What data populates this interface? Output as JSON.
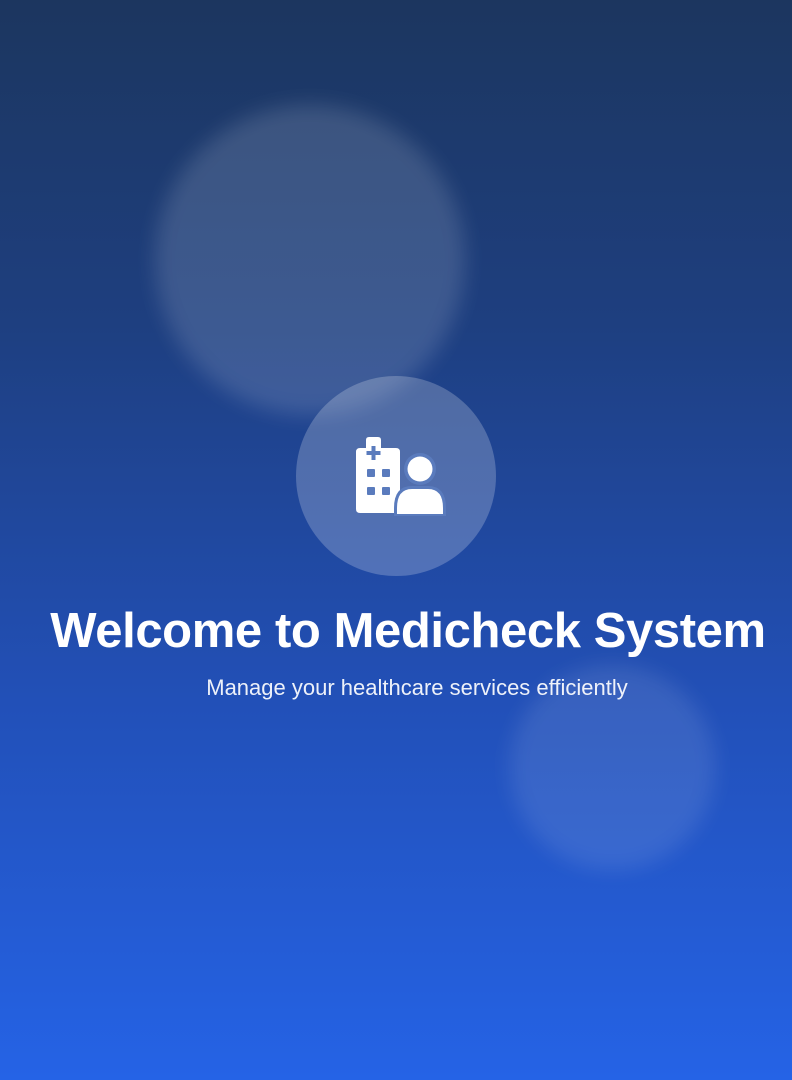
{
  "welcome": {
    "title": "Welcome to Medicheck System",
    "subtitle": "Manage your healthcare services efficiently",
    "logo_icon": "hospital-user-icon"
  },
  "colors": {
    "background_top": "#1c365f",
    "background_bottom": "#2563e6",
    "icon": "#ffffff",
    "text": "#ffffff"
  }
}
